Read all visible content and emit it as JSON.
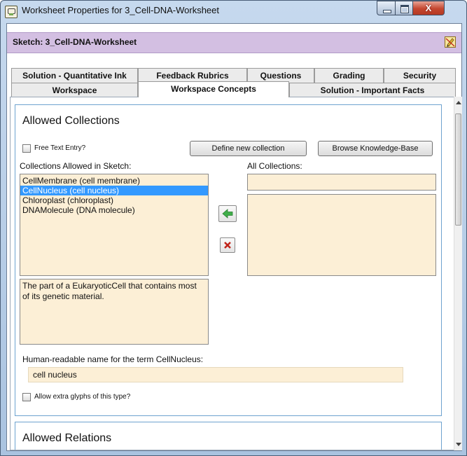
{
  "window": {
    "title": "Worksheet Properties for 3_Cell-DNA-Worksheet",
    "close_label": "X"
  },
  "sketch": {
    "title": "Sketch: 3_Cell-DNA-Worksheet"
  },
  "tabs_row1": [
    {
      "label": "Solution - Quantitative Ink"
    },
    {
      "label": "Feedback Rubrics"
    },
    {
      "label": "Questions"
    },
    {
      "label": "Grading"
    },
    {
      "label": "Security"
    }
  ],
  "tabs_row2": [
    {
      "label": "Workspace"
    },
    {
      "label": "Workspace Concepts",
      "active": true
    },
    {
      "label": "Solution - Important Facts"
    }
  ],
  "allowed_collections": {
    "title": "Allowed Collections",
    "free_text_label": "Free Text Entry?",
    "define_button": "Define new collection",
    "browse_button": "Browse Knowledge-Base",
    "allowed_label": "Collections Allowed in Sketch:",
    "all_label": "All Collections:",
    "items": [
      {
        "text": "CellMembrane  (cell membrane)",
        "selected": false
      },
      {
        "text": "CellNucleus  (cell nucleus)",
        "selected": true
      },
      {
        "text": "Chloroplast  (chloroplast)",
        "selected": false
      },
      {
        "text": "DNAMolecule  (DNA molecule)",
        "selected": false
      }
    ],
    "description": "The part of a EukaryoticCell that contains most of its genetic material.",
    "human_name_label": "Human-readable name for the term CellNucleus:",
    "human_name_value": "cell nucleus",
    "extra_glyphs_label": "Allow extra glyphs of this type?"
  },
  "allowed_relations": {
    "title": "Allowed Relations"
  },
  "icons": {
    "add_arrow": "arrow-left-icon",
    "remove": "delete-x-icon",
    "pen": "pen-edit-icon",
    "app": "worksheet-app-icon"
  },
  "colors": {
    "selection": "#3399ff",
    "field_bg": "#fcefd6",
    "header_bg": "#d3bfe2",
    "section_border": "#6ea3cf",
    "arrow_green": "#3fae49",
    "remove_red": "#c0241a"
  }
}
